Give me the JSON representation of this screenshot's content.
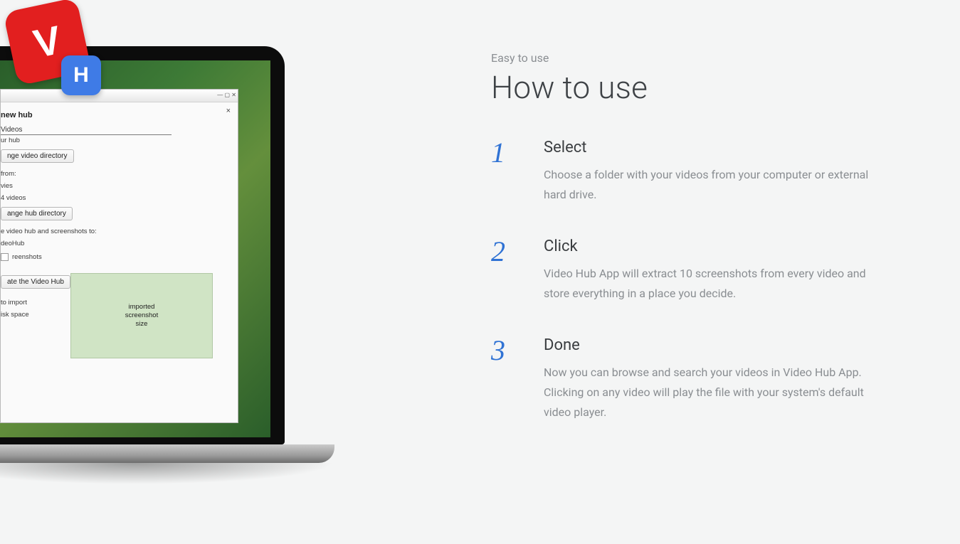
{
  "logo": {
    "letters": [
      "V",
      "H"
    ]
  },
  "content": {
    "eyebrow": "Easy to use",
    "headline": "How to use",
    "steps": [
      {
        "num": "1",
        "title": "Select",
        "desc": "Choose a folder with your videos from your computer or external hard drive."
      },
      {
        "num": "2",
        "title": "Click",
        "desc": "Video Hub App will extract 10 screenshots from every video and store everything in a place you decide."
      },
      {
        "num": "3",
        "title": "Done",
        "desc": "Now you can browse and search your videos in Video Hub App. Clicking on any video will play the file with your system's default video player."
      }
    ]
  },
  "app": {
    "wizard_title": "new hub",
    "hub_name_value": "Videos",
    "hub_name_hint": "ur hub",
    "btn_change_video_dir": "nge video directory",
    "source_from_label": "from:",
    "source_path": "vies",
    "source_count": "4 videos",
    "btn_change_hub_dir": "ange hub directory",
    "save_dest_label": "e video hub and screenshots to:",
    "save_dest_path": "deoHub",
    "screenshots_label": "reenshots",
    "btn_create_hub": "ate the Video Hub",
    "import_label_1": "to import",
    "import_label_2": "isk space",
    "preview_text": "imported\nscreenshot\nsize",
    "close": "×"
  }
}
